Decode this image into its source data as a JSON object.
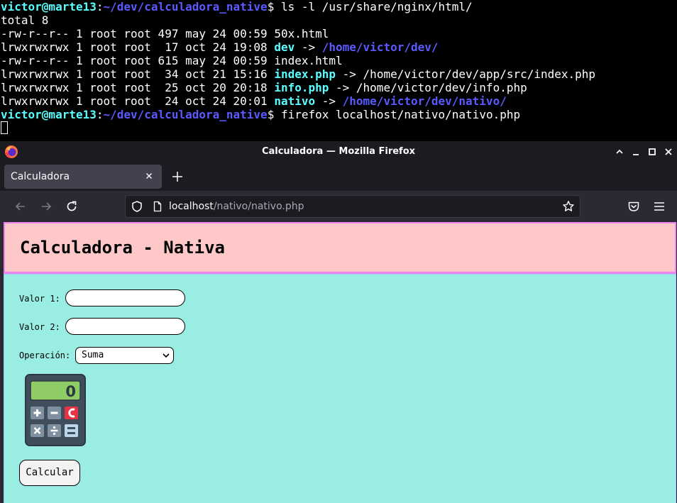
{
  "terminal": {
    "prompt_user": "victor@marte13",
    "prompt_sep": ":",
    "prompt_path": "~/dev/calculadora_native",
    "prompt_symbol": "$",
    "command1": " ls -l /usr/share/nginx/html/",
    "total": "total 8",
    "entries": [
      {
        "meta": "-rw-r--r-- 1 root root 497 may 24 00:59 ",
        "name": "50x.html",
        "is_link": false,
        "arrow": "",
        "target": ""
      },
      {
        "meta": "lrwxrwxrwx 1 root root  17 oct 24 19:08 ",
        "name": "dev",
        "is_link": true,
        "arrow": " -> ",
        "target": "/home/victor/dev/"
      },
      {
        "meta": "-rw-r--r-- 1 root root 615 may 24 00:59 ",
        "name": "index.html",
        "is_link": false,
        "arrow": "",
        "target": ""
      },
      {
        "meta": "lrwxrwxrwx 1 root root  34 oct 21 15:16 ",
        "name": "index.php",
        "is_link": true,
        "arrow": " -> ",
        "target": "/home/victor/dev/app/src/index.php"
      },
      {
        "meta": "lrwxrwxrwx 1 root root  25 oct 20 20:18 ",
        "name": "info.php",
        "is_link": true,
        "arrow": " -> ",
        "target": "/home/victor/dev/info.php"
      },
      {
        "meta": "lrwxrwxrwx 1 root root  24 oct 24 20:01 ",
        "name": "nativo",
        "is_link": true,
        "arrow": " -> ",
        "target": "/home/victor/dev/nativo/"
      }
    ],
    "command2": " firefox localhost/nativo/nativo.php"
  },
  "browser": {
    "window_title": "Calculadora — Mozilla Firefox",
    "tab_title": "Calculadora",
    "url_host": "localhost",
    "url_path": "/nativo/nativo.php"
  },
  "page": {
    "title": "Calculadora - Nativa",
    "valor1_label": "Valor 1:",
    "valor1_value": "",
    "valor2_label": "Valor 2:",
    "valor2_value": "",
    "operacion_label": "Operación:",
    "operacion_selected": "Suma",
    "calc_display": "0",
    "submit_label": "Calcular"
  },
  "colors": {
    "header_bg": "#ffc8c8",
    "header_border": "#ee82ee",
    "body_bg": "#99ede2",
    "terminal_user": "#59ffff",
    "terminal_path": "#5a5aff"
  }
}
